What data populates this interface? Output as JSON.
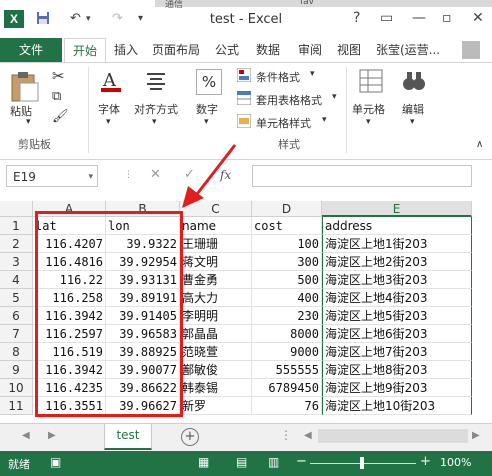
{
  "window": {
    "title": "test - Excel",
    "app_icon_text": "X",
    "top_strip": [
      "通信",
      "fav"
    ],
    "controls": [
      "?",
      "▭",
      "—",
      "▫",
      "✕"
    ]
  },
  "quick_access": {
    "undo": "↶",
    "redo": "↷"
  },
  "ribbon_tabs": {
    "file": "文件",
    "tabs": [
      "开始",
      "插入",
      "页面布局",
      "公式",
      "数据",
      "审阅",
      "视图"
    ],
    "active": "开始",
    "user": "张莹(运营..."
  },
  "ribbon": {
    "clipboard": {
      "paste": "粘贴",
      "group": "剪贴板"
    },
    "font": {
      "label": "字体"
    },
    "alignment": {
      "label": "对齐方式"
    },
    "number": {
      "label": "数字",
      "symbol": "%"
    },
    "styles": {
      "conditional": "条件格式",
      "table": "套用表格格式",
      "cell_styles": "单元格样式",
      "group": "样式"
    },
    "cells": {
      "label": "单元格"
    },
    "editing": {
      "label": "编辑"
    }
  },
  "formula_bar": {
    "name_box": "E19",
    "cancel": "✕",
    "enter": "✓",
    "fx": "fx",
    "value": ""
  },
  "grid": {
    "columns": [
      "A",
      "B",
      "C",
      "D",
      "E"
    ],
    "selected_column": "E",
    "rows": [
      [
        "lat",
        "lon",
        "name",
        "cost",
        "address"
      ],
      [
        "116.4207",
        "39.9322",
        "王珊珊",
        "100",
        "海淀区上地1街203"
      ],
      [
        "116.4816",
        "39.92954",
        "蒋文明",
        "300",
        "海淀区上地2街203"
      ],
      [
        "116.22",
        "39.93131",
        "曹金勇",
        "500",
        "海淀区上地3街203"
      ],
      [
        "116.258",
        "39.89191",
        "高大力",
        "400",
        "海淀区上地4街203"
      ],
      [
        "116.3942",
        "39.91405",
        "李明明",
        "230",
        "海淀区上地5街203"
      ],
      [
        "116.2597",
        "39.96583",
        "郭晶晶",
        "8000",
        "海淀区上地6街203"
      ],
      [
        "116.519",
        "39.88925",
        "范晓萱",
        "9000",
        "海淀区上地7街203"
      ],
      [
        "116.3942",
        "39.90077",
        "鄯敏俊",
        "555555",
        "海淀区上地8街203"
      ],
      [
        "116.4235",
        "39.86622",
        "韩泰锡",
        "6789450",
        "海淀区上地9街203"
      ],
      [
        "116.3551",
        "39.96627",
        "新罗",
        "76",
        "海淀区上地10街203"
      ]
    ]
  },
  "sheets": {
    "tabs": [
      "test"
    ],
    "add": "+"
  },
  "status_bar": {
    "ready": "就绪",
    "zoom": "100%",
    "zoom_minus": "−",
    "zoom_plus": "+"
  },
  "colors": {
    "excel_green": "#217346",
    "annotation_red": "#e01e1e"
  }
}
